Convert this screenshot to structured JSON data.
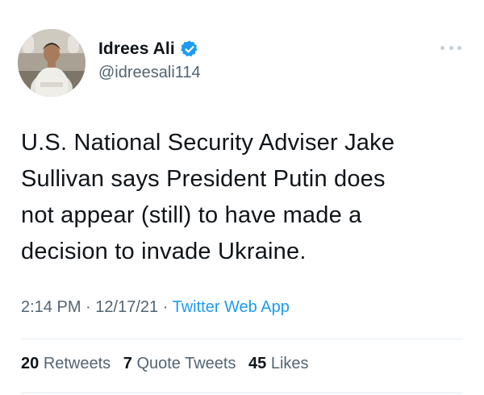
{
  "author": {
    "display_name": "Idrees Ali",
    "handle": "@idreesali114",
    "verified": true,
    "avatar": "profile-photo"
  },
  "more_icon": "more-horizontal-icon",
  "tweet": {
    "text_lines": [
      "U.S. National Security Adviser Jake",
      "Sullivan says President Putin does",
      "not appear (still) to have made a",
      "decision to invade Ukraine."
    ]
  },
  "meta": {
    "time": "2:14 PM",
    "separator": "·",
    "date": "12/17/21",
    "source": "Twitter Web App"
  },
  "stats": {
    "retweets_count": "20",
    "retweets_label": "Retweets",
    "quotes_count": "7",
    "quotes_label": "Quote Tweets",
    "likes_count": "45",
    "likes_label": "Likes"
  },
  "colors": {
    "text": "#0f1419",
    "secondary": "#536471",
    "accent": "#1d9bf0",
    "divider": "#e6ecf0"
  }
}
